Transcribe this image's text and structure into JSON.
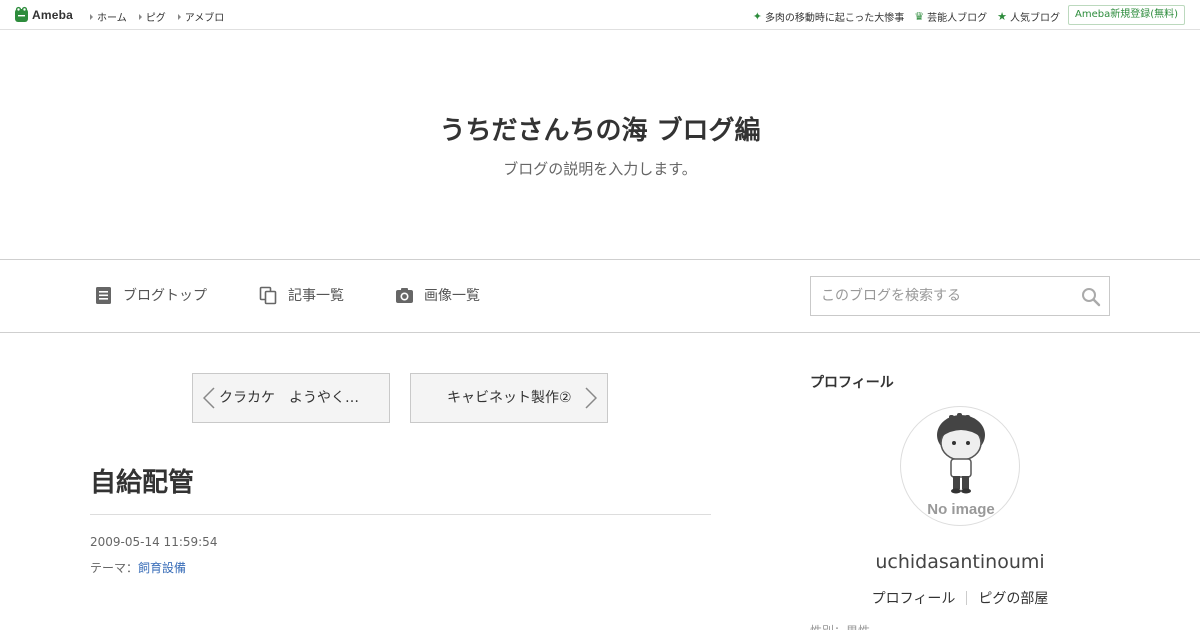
{
  "topbar": {
    "logo_text": "Ameba",
    "nav": [
      {
        "label": "ホーム"
      },
      {
        "label": "ピグ"
      },
      {
        "label": "アメブロ"
      }
    ],
    "links": [
      {
        "label": "多肉の移動時に起こった大惨事",
        "icon": "sparkle-icon"
      },
      {
        "label": "芸能人ブログ",
        "icon": "crown-icon"
      },
      {
        "label": "人気ブログ",
        "icon": "star-icon"
      }
    ],
    "register_label": "Ameba新規登録(無料)"
  },
  "blog": {
    "title": "うちださんちの海 ブログ編",
    "description": "ブログの説明を入力します。"
  },
  "blognav": {
    "items": [
      {
        "label": "ブログトップ",
        "icon": "document-icon"
      },
      {
        "label": "記事一覧",
        "icon": "copy-icon"
      },
      {
        "label": "画像一覧",
        "icon": "camera-icon"
      }
    ],
    "search_placeholder": "このブログを検索する"
  },
  "main": {
    "prev_label": "クラカケ　ようやく…",
    "next_label": "キャビネット製作②",
    "entry_title": "自給配管",
    "entry_date": "2009-05-14 11:59:54",
    "theme_prefix": "テーマ：",
    "theme_link": "飼育設備"
  },
  "sidebar": {
    "heading": "プロフィール",
    "avatar_caption": "No image",
    "username": "uchidasantinoumi",
    "profile_links": [
      {
        "label": "プロフィール"
      },
      {
        "label": "ピグの部屋"
      }
    ],
    "cutoff_text": "性別：男性"
  },
  "colors": {
    "accent_green": "#2d8c3c",
    "link_blue": "#3a6eb8",
    "pager_bg": "#f4f4f4"
  }
}
